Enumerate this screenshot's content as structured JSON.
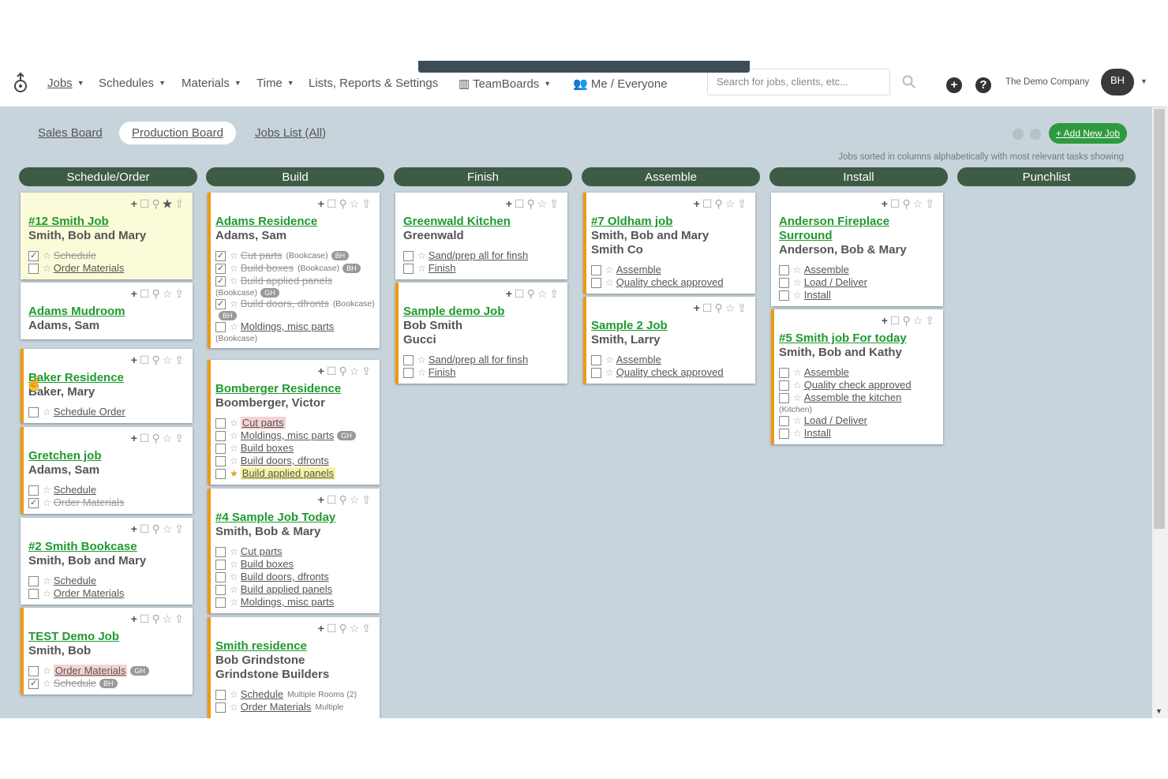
{
  "nav": {
    "items": [
      {
        "label": "Jobs",
        "caret": true,
        "active": true
      },
      {
        "label": "Schedules",
        "caret": true
      },
      {
        "label": "Materials",
        "caret": true
      },
      {
        "label": "Time",
        "caret": true
      },
      {
        "label": "Lists, Reports & Settings",
        "caret": false
      },
      {
        "label": "TeamBoards",
        "caret": true
      },
      {
        "label": "Me / Everyone",
        "caret": false
      }
    ],
    "search_placeholder": "Search for jobs, clients, etc...",
    "company": "The Demo Company",
    "avatar": "BH"
  },
  "board": {
    "tabs": [
      "Sales Board",
      "Production Board",
      "Jobs List (All)"
    ],
    "active_tab": "Production Board",
    "add_job": "Add New Job",
    "sort_note": "Jobs sorted in columns alphabetically with most relevant tasks showing",
    "columns": [
      "Schedule/Order",
      "Build",
      "Finish",
      "Assemble",
      "Install",
      "Punchlist"
    ]
  },
  "cards": [
    {
      "col": 0,
      "title": "#12 Smith Job",
      "sub": [
        "Smith, Bob and Mary"
      ],
      "style": "yellow",
      "starred": true,
      "tasks": [
        {
          "label": "Schedule",
          "checked": true,
          "done": true
        },
        {
          "label": "Order Materials",
          "checked": false
        }
      ]
    },
    {
      "col": 0,
      "title": "Adams Mudroom",
      "sub": [
        "Adams, Sam"
      ],
      "style": "plain",
      "tasks": []
    },
    {
      "col": 0,
      "title": "Baker Residence",
      "sub": [
        "Baker, Mary"
      ],
      "style": "orange",
      "tasks": [
        {
          "label": "Schedule Order",
          "checked": false
        }
      ]
    },
    {
      "col": 0,
      "title": "Gretchen job",
      "sub": [
        "Adams, Sam"
      ],
      "style": "orange",
      "tasks": [
        {
          "label": "Schedule",
          "checked": false
        },
        {
          "label": "Order Materials",
          "checked": true,
          "done": true
        }
      ]
    },
    {
      "col": 0,
      "title": "#2 Smith Bookcase",
      "sub": [
        "Smith, Bob and Mary"
      ],
      "style": "plain",
      "tasks": [
        {
          "label": "Schedule",
          "checked": false
        },
        {
          "label": "Order Materials",
          "checked": false
        }
      ]
    },
    {
      "col": 0,
      "title": "TEST Demo Job",
      "sub": [
        "Smith, Bob"
      ],
      "style": "orange",
      "tasks": [
        {
          "label": "Order Materials",
          "checked": false,
          "hl": "pink",
          "starColor": "red",
          "pill": "GH"
        },
        {
          "label": "Schedule",
          "checked": true,
          "done": true,
          "pill": "BH"
        }
      ]
    },
    {
      "col": 1,
      "title": "Adams Residence",
      "sub": [
        "Adams, Sam"
      ],
      "style": "orange",
      "tasks": [
        {
          "label": "Cut parts",
          "checked": true,
          "done": true,
          "note": "(Bookcase)",
          "pill": "BH"
        },
        {
          "label": "Build boxes",
          "checked": true,
          "done": true,
          "note": "(Bookcase)",
          "pill": "BH"
        },
        {
          "label": "Build applied panels",
          "checked": true,
          "done": true
        },
        {
          "label": "",
          "noteOnly": "(Bookcase)",
          "pill": "GH"
        },
        {
          "label": "Build doors, dfronts",
          "checked": true,
          "done": true,
          "note": "(Bookcase)"
        },
        {
          "label": "",
          "pillOnly": "BH"
        },
        {
          "label": "Moldings, misc parts",
          "checked": false
        },
        {
          "label": "",
          "noteOnly": "(Bookcase)"
        }
      ]
    },
    {
      "col": 1,
      "title": "Bomberger Residence",
      "sub": [
        "Boomberger, Victor"
      ],
      "style": "orange",
      "tasks": [
        {
          "label": "Cut parts",
          "checked": false,
          "hl": "pink",
          "starColor": "red"
        },
        {
          "label": "Moldings, misc parts",
          "checked": false,
          "pill": "GH"
        },
        {
          "label": "Build boxes",
          "checked": false
        },
        {
          "label": "Build doors, dfronts",
          "checked": false
        },
        {
          "label": "Build applied panels",
          "checked": false,
          "hl": "yellow",
          "starColor": "gold"
        }
      ]
    },
    {
      "col": 1,
      "title": "#4 Sample Job Today",
      "sub": [
        "Smith, Bob & Mary"
      ],
      "style": "orange",
      "tasks": [
        {
          "label": "Cut parts",
          "checked": false
        },
        {
          "label": "Build boxes",
          "checked": false
        },
        {
          "label": "Build doors, dfronts",
          "checked": false
        },
        {
          "label": "Build applied panels",
          "checked": false
        },
        {
          "label": "Moldings, misc parts",
          "checked": false
        }
      ]
    },
    {
      "col": 1,
      "title": "Smith residence",
      "sub": [
        "Bob Grindstone",
        "Grindstone Builders"
      ],
      "style": "orange",
      "tasks": [
        {
          "label": "Schedule",
          "checked": false,
          "note": "Multiple Rooms (2)"
        },
        {
          "label": "Order Materials",
          "checked": false,
          "note": "Multiple"
        }
      ]
    },
    {
      "col": 2,
      "title": "Greenwald Kitchen",
      "sub": [
        "Greenwald"
      ],
      "style": "plain",
      "tasks": [
        {
          "label": "Sand/prep all for finsh",
          "checked": false
        },
        {
          "label": "Finish",
          "checked": false
        }
      ]
    },
    {
      "col": 2,
      "title": "Sample demo Job",
      "sub": [
        "Bob Smith",
        "Gucci"
      ],
      "style": "orange",
      "tasks": [
        {
          "label": "Sand/prep all for finsh",
          "checked": false
        },
        {
          "label": "Finish",
          "checked": false
        }
      ]
    },
    {
      "col": 3,
      "title": "#7 Oldham job",
      "sub": [
        "Smith, Bob and Mary",
        "Smith Co"
      ],
      "style": "orange",
      "tasks": [
        {
          "label": "Assemble",
          "checked": false
        },
        {
          "label": "Quality check approved",
          "checked": false
        }
      ]
    },
    {
      "col": 3,
      "title": "Sample 2 Job",
      "sub": [
        "Smith, Larry"
      ],
      "style": "orange",
      "tasks": [
        {
          "label": "Assemble",
          "checked": false
        },
        {
          "label": "Quality check approved",
          "checked": false
        }
      ]
    },
    {
      "col": 4,
      "title": "Anderson Fireplace Surround",
      "sub": [
        "Anderson, Bob & Mary"
      ],
      "style": "plain",
      "tasks": [
        {
          "label": "Assemble",
          "checked": false
        },
        {
          "label": "Load / Deliver",
          "checked": false
        },
        {
          "label": "Install",
          "checked": false
        }
      ]
    },
    {
      "col": 4,
      "title": "#5 Smith job For today",
      "sub": [
        "Smith, Bob and Kathy"
      ],
      "style": "orange",
      "tasks": [
        {
          "label": "Assemble",
          "checked": false
        },
        {
          "label": "Quality check approved",
          "checked": false
        },
        {
          "label": "Assemble the kitchen",
          "checked": false
        },
        {
          "label": "",
          "noteOnly": "(Kitchen)"
        },
        {
          "label": "Load / Deliver",
          "checked": false
        },
        {
          "label": "Install",
          "checked": false
        }
      ]
    }
  ]
}
